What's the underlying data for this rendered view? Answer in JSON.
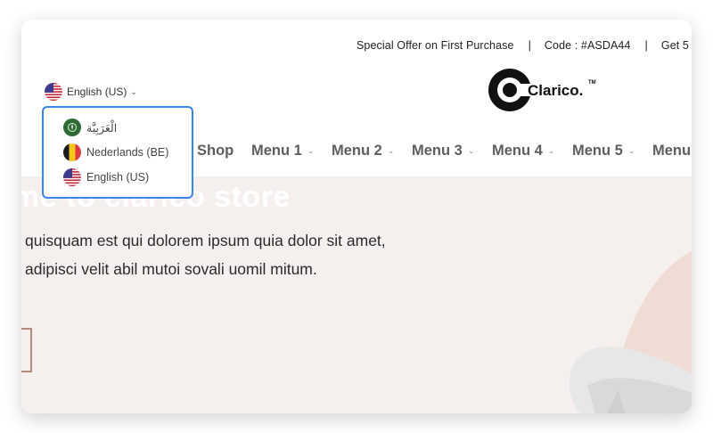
{
  "topbar": {
    "offer": "Special Offer on First Purchase",
    "separator": "|",
    "code": "Code : #ASDA44",
    "extra": "Get 5"
  },
  "language": {
    "current": "English (US)",
    "options": [
      {
        "label": "الْعَرَبِيَّة",
        "flag": "arabic-flag"
      },
      {
        "label": "Nederlands (BE)",
        "flag": "belgium-flag"
      },
      {
        "label": "English (US)",
        "flag": "us-flag"
      }
    ]
  },
  "logo": {
    "text": "Clarico.",
    "tm": "TM"
  },
  "nav": {
    "items": [
      "Shop",
      "Menu 1",
      "Menu 2",
      "Menu 3",
      "Menu 4",
      "Menu 5",
      "Menu"
    ]
  },
  "hero": {
    "title": "me to clarico store",
    "line1": "quisquam est qui dolorem ipsum quia dolor sit amet,",
    "line2": "adipisci velit abil mutoi sovali uomil mitum."
  },
  "colors": {
    "accent_border": "#3a86e6",
    "hero_bg": "#f5f0ee",
    "nav_text": "#5e5e5e",
    "button_border": "#b38a7c"
  }
}
